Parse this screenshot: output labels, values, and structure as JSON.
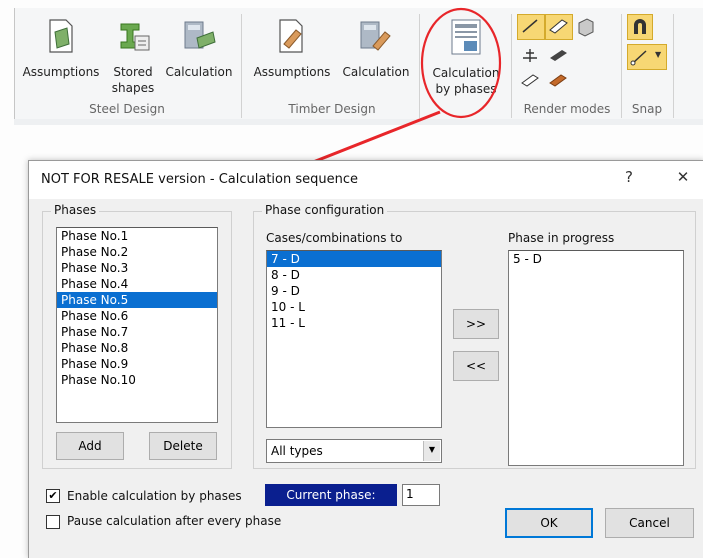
{
  "ribbon": {
    "steel_group_label": "Steel Design",
    "timber_group_label": "Timber Design",
    "render_group_label": "Render modes",
    "snap_group_label": "Snap",
    "steel_buttons": [
      {
        "label_line1": "Assumptions",
        "label_line2": ""
      },
      {
        "label_line1": "Stored",
        "label_line2": "shapes"
      },
      {
        "label_line1": "Calculation",
        "label_line2": ""
      }
    ],
    "timber_buttons": [
      {
        "label_line1": "Assumptions",
        "label_line2": ""
      },
      {
        "label_line1": "Calculation",
        "label_line2": ""
      }
    ],
    "phases_button": {
      "label_line1": "Calculation",
      "label_line2": "by phases"
    },
    "highlight_color": "#e8262a"
  },
  "dialog": {
    "title": "NOT FOR RESALE version - Calculation sequence",
    "help_symbol": "?",
    "close_symbol": "✕",
    "phases_group_label": "Phases",
    "phases": [
      "Phase No.1",
      "Phase No.2",
      "Phase No.3",
      "Phase No.4",
      "Phase No.5",
      "Phase No.6",
      "Phase No.7",
      "Phase No.8",
      "Phase No.9",
      "Phase No.10"
    ],
    "selected_phase_index": 4,
    "add_label": "Add",
    "delete_label": "Delete",
    "config_group_label": "Phase configuration",
    "cases_label": "Cases/combinations to",
    "cases": [
      "7 - D",
      "8 - D",
      "9 - D",
      "10 - L",
      "11 - L"
    ],
    "selected_case_index": 0,
    "move_right_label": ">>",
    "move_left_label": "<<",
    "in_progress_label": "Phase in progress",
    "in_progress": [
      "5 - D"
    ],
    "filter_value": "All types",
    "enable_label": "Enable calculation by phases",
    "enable_checked": true,
    "pause_label": "Pause calculation after every phase",
    "pause_checked": false,
    "current_phase_label": "Current phase:",
    "current_phase_value": "1",
    "ok_label": "OK",
    "cancel_label": "Cancel"
  }
}
